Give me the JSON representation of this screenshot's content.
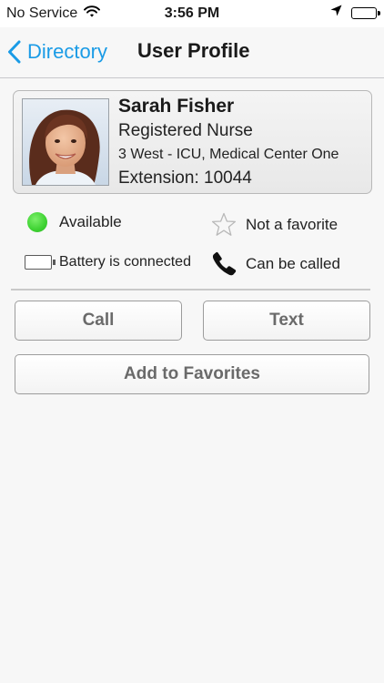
{
  "status_bar": {
    "carrier": "No Service",
    "time": "3:56 PM",
    "icons": [
      "wifi-icon",
      "location-arrow-icon",
      "battery-icon"
    ]
  },
  "nav": {
    "back_label": "Directory",
    "title": "User Profile"
  },
  "profile": {
    "name": "Sarah Fisher",
    "role": "Registered Nurse",
    "location": "3 West - ICU, Medical Center One",
    "extension": "Extension: 10044"
  },
  "statuses": {
    "presence": "Available",
    "favorite": "Not a favorite",
    "battery": "Battery is connected",
    "callable": "Can be called"
  },
  "actions": {
    "call": "Call",
    "text": "Text",
    "add_favorites": "Add to Favorites"
  },
  "colors": {
    "accent": "#1a9be6",
    "available": "#3ed232",
    "button_text": "#6a6a6a"
  }
}
